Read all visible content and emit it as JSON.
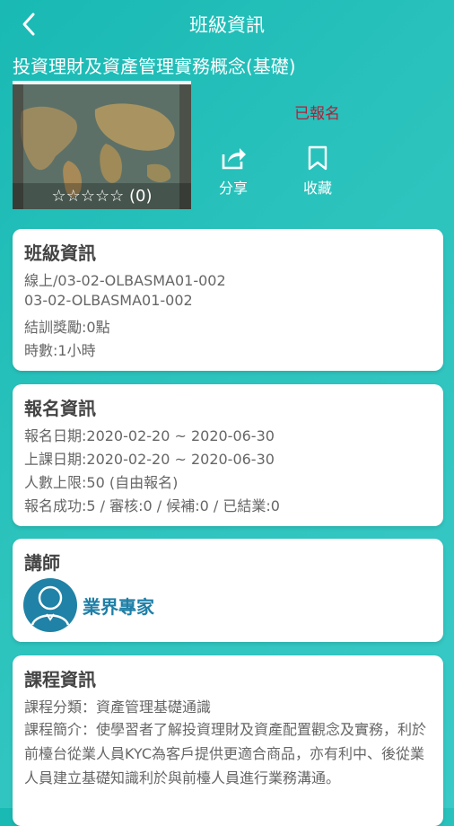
{
  "header": {
    "title": "班級資訊"
  },
  "course": {
    "title": "投資理財及資產管理實務概念(基礎)",
    "rating_count": "(0)",
    "status": "已報名"
  },
  "actions": {
    "share": "分享",
    "bookmark": "收藏"
  },
  "class_info": {
    "title": "班級資訊",
    "lines": [
      "線上/03-02-OLBASMA01-002",
      "03-02-OLBASMA01-002",
      "結訓獎勵:0點",
      "時數:1小時"
    ]
  },
  "registration": {
    "title": "報名資訊",
    "lines": [
      "報名日期:2020-02-20 ~ 2020-06-30",
      "上課日期:2020-02-20 ~ 2020-06-30",
      "人數上限:50 (自由報名)",
      "報名成功:5 / 審核:0 / 候補:0 / 已結業:0"
    ]
  },
  "instructor": {
    "title": "講師",
    "name": "業界專家"
  },
  "course_info": {
    "title": "課程資訊",
    "category": "課程分類：資產管理基礎通識",
    "description": "課程簡介：使學習者了解投資理財及資產配置觀念及實務，利於前檯台從業人員KYC為客戶提供更適合商品，亦有利中、後從業人員建立基礎知識利於與前檯人員進行業務溝通。"
  },
  "colors": {
    "accent": "#19b9b4",
    "status": "#b0213a",
    "instructor": "#1f7fa6"
  }
}
